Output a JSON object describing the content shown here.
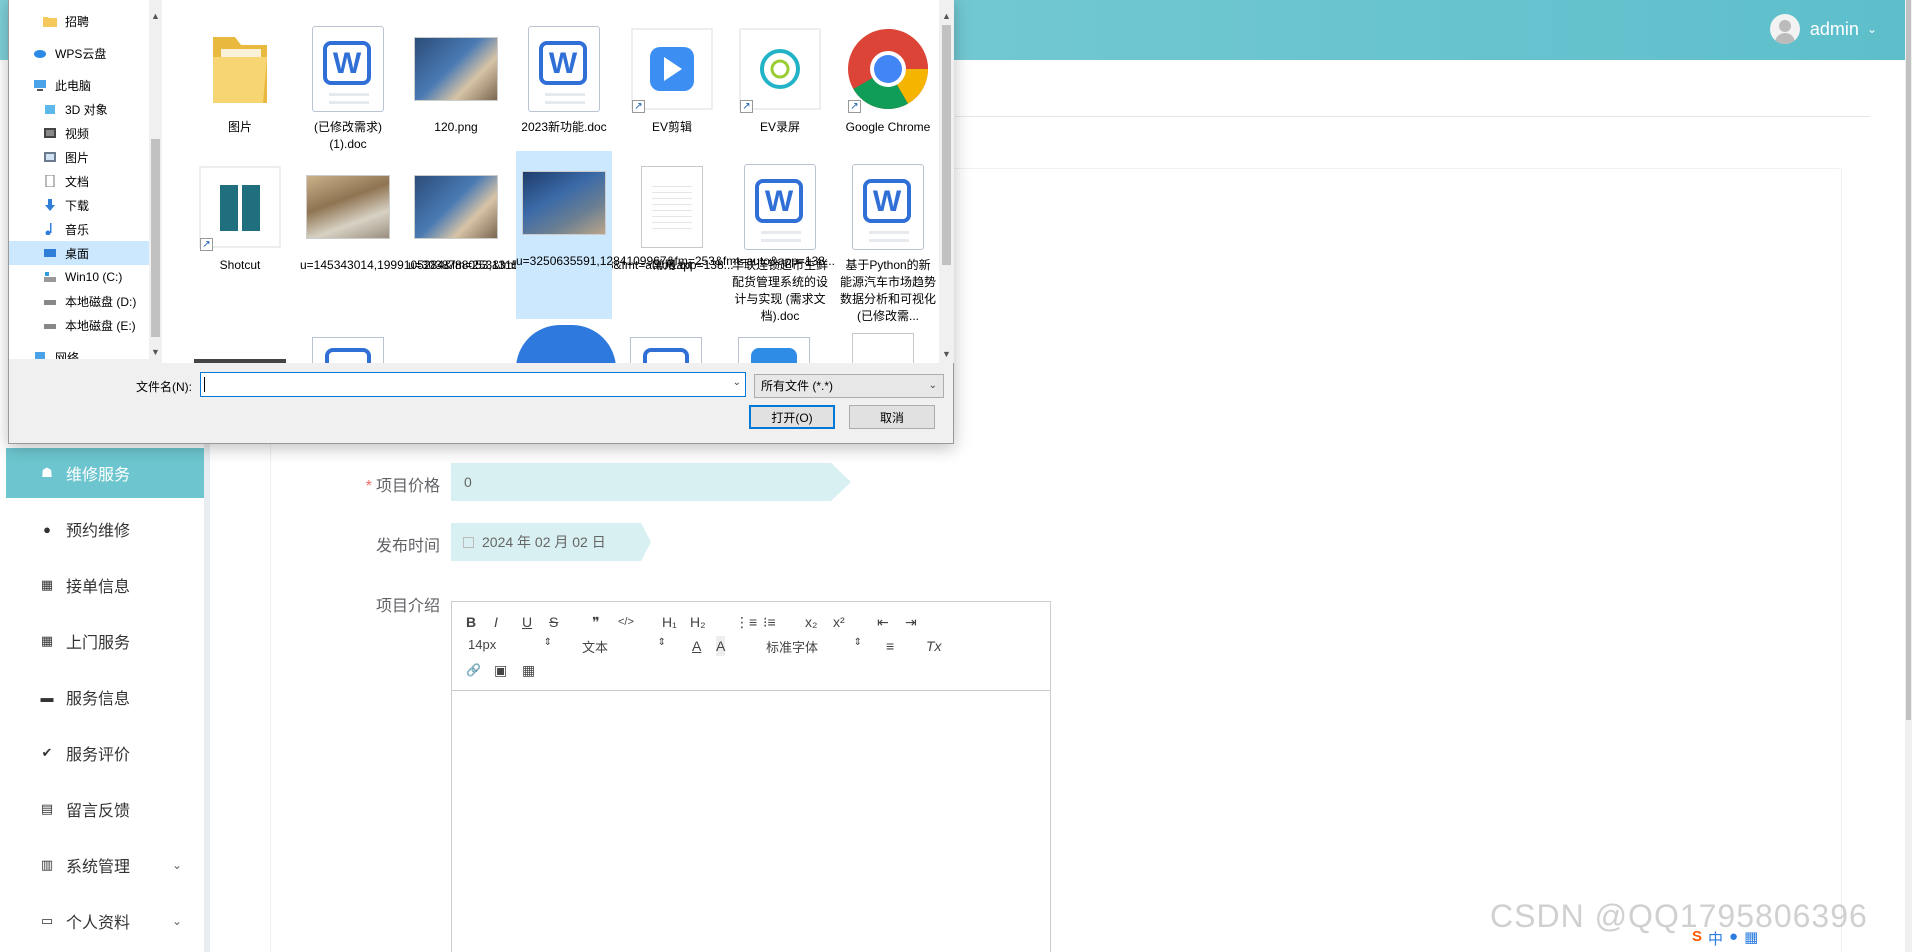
{
  "header": {
    "username": "admin",
    "caret": "⌄"
  },
  "sidebar": {
    "items": [
      {
        "label": "维修服务",
        "icon": "☗",
        "active": true
      },
      {
        "label": "预约维修",
        "icon": "●",
        "active": false
      },
      {
        "label": "接单信息",
        "icon": "▦",
        "active": false
      },
      {
        "label": "上门服务",
        "icon": "▦",
        "active": false
      },
      {
        "label": "服务信息",
        "icon": "▬",
        "active": false
      },
      {
        "label": "服务评价",
        "icon": "✔",
        "active": false
      },
      {
        "label": "留言反馈",
        "icon": "▤",
        "active": false
      },
      {
        "label": "系统管理",
        "icon": "▥",
        "active": false,
        "chevron": "⌄"
      },
      {
        "label": "个人资料",
        "icon": "▭",
        "active": false,
        "chevron": "⌄"
      }
    ]
  },
  "form": {
    "price_label": "项目价格",
    "price_required": "*",
    "price_value": "0",
    "date_label": "发布时间",
    "date_value": "2024 年 02 月 02 日",
    "intro_label": "项目介绍"
  },
  "editor": {
    "bold": "B",
    "italic": "I",
    "underline": "U",
    "strike": "S",
    "quote": "❞",
    "code": "</>",
    "h1": "H₁",
    "h2": "H₂",
    "ordered_list": "⋮≡",
    "bullet_list": "⁝≡",
    "subscript": "x₂",
    "superscript": "x²",
    "outdent": "⇤",
    "indent": "⇥",
    "size_value": "14px",
    "text_value": "文本",
    "font_value": "标准字体",
    "color": "A",
    "background": "A",
    "align": "≡",
    "clean": "Tx",
    "link": "🔗",
    "image": "▣",
    "video": "▦"
  },
  "dialog": {
    "nav": [
      {
        "label": "招聘",
        "icon": "folder"
      },
      {
        "label": "WPS云盘",
        "icon": "cloud"
      },
      {
        "label": "此电脑",
        "icon": "pc"
      },
      {
        "label": "3D 对象",
        "icon": "cube"
      },
      {
        "label": "视频",
        "icon": "video"
      },
      {
        "label": "图片",
        "icon": "picture"
      },
      {
        "label": "文档",
        "icon": "doc"
      },
      {
        "label": "下载",
        "icon": "download"
      },
      {
        "label": "音乐",
        "icon": "music"
      },
      {
        "label": "桌面",
        "icon": "desktop",
        "selected": true
      },
      {
        "label": "Win10 (C:)",
        "icon": "drive"
      },
      {
        "label": "本地磁盘 (D:)",
        "icon": "drive"
      },
      {
        "label": "本地磁盘 (E:)",
        "icon": "drive"
      },
      {
        "label": "网络",
        "icon": "network"
      }
    ],
    "files": [
      {
        "name": "图片",
        "type": "folder"
      },
      {
        "name": "(已修改需求)(1).doc",
        "type": "wps-doc"
      },
      {
        "name": "120.png",
        "type": "photo"
      },
      {
        "name": "2023新功能.doc",
        "type": "wps-doc"
      },
      {
        "name": "EV剪辑",
        "type": "ev-edit"
      },
      {
        "name": "EV录屏",
        "type": "ev-record"
      },
      {
        "name": "Google Chrome",
        "type": "chrome"
      },
      {
        "name": "Shotcut",
        "type": "shotcut"
      },
      {
        "name": "u=145343014,1999105284&fm=253&fmt=auto&app=138...",
        "type": "photo"
      },
      {
        "name": "u=3038788053,13159833898&fm=253&fmt=auto&app=138...",
        "type": "photo"
      },
      {
        "name": "u=3250635591,1284109967&fm=253&fmt=auto&app=138...",
        "type": "photo",
        "selected": true
      },
      {
        "name": "常用.txt",
        "type": "txt"
      },
      {
        "name": "华联连锁超市生鲜配货管理系统的设计与实现 (需求文档).doc",
        "type": "wps-doc"
      },
      {
        "name": "基于Python的新能源汽车市场趋势数据分析和可视化(已修改需...",
        "type": "wps-doc"
      }
    ],
    "filename_label": "文件名(N):",
    "filename_value": "",
    "filetype_value": "所有文件 (*.*)",
    "open_button": "打开(O)",
    "cancel_button": "取消"
  },
  "watermark": "CSDN @QQ1795806396",
  "tray": {
    "ime": "中",
    "s5": "S"
  },
  "colors": {
    "header": "#72c8d2",
    "active_nav": "#6dc6cf",
    "field_bg": "#d9f0f2",
    "required": "#f56c6c",
    "dialog_bg": "#f0f0f0",
    "selection": "#cce8ff"
  }
}
